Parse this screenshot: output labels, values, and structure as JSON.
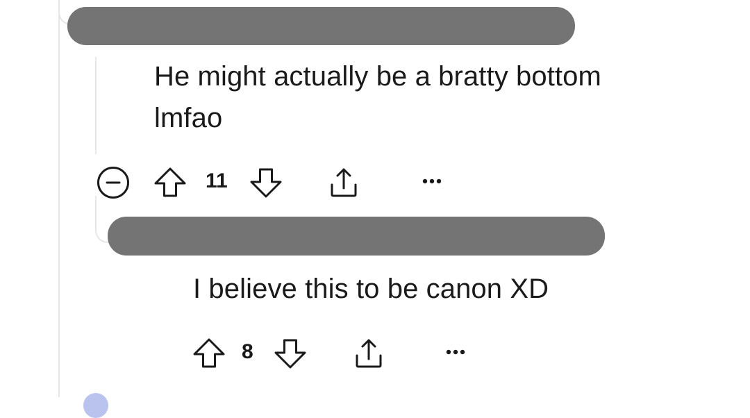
{
  "comments": [
    {
      "author_redacted": true,
      "text_lines": [
        "He might actually be a bratty bottom",
        "lmfao"
      ],
      "score": "11",
      "collapse_icon": "collapse-minus-icon",
      "upvote_icon": "arrow-up-outline-icon",
      "downvote_icon": "arrow-down-outline-icon",
      "share_icon": "share-upload-icon",
      "more_icon": "ellipsis-icon"
    },
    {
      "author_redacted": true,
      "text_lines": [
        "I believe this to be canon XD"
      ],
      "score": "8",
      "upvote_icon": "arrow-up-outline-icon",
      "downvote_icon": "arrow-down-outline-icon",
      "share_icon": "share-upload-icon",
      "more_icon": "ellipsis-icon"
    }
  ],
  "colors": {
    "redaction": "#747474",
    "text": "#1a1a1b",
    "thread_line": "#e6e6e6",
    "icon": "#1a1a1b",
    "avatar_peek": "#b9c3ee"
  }
}
